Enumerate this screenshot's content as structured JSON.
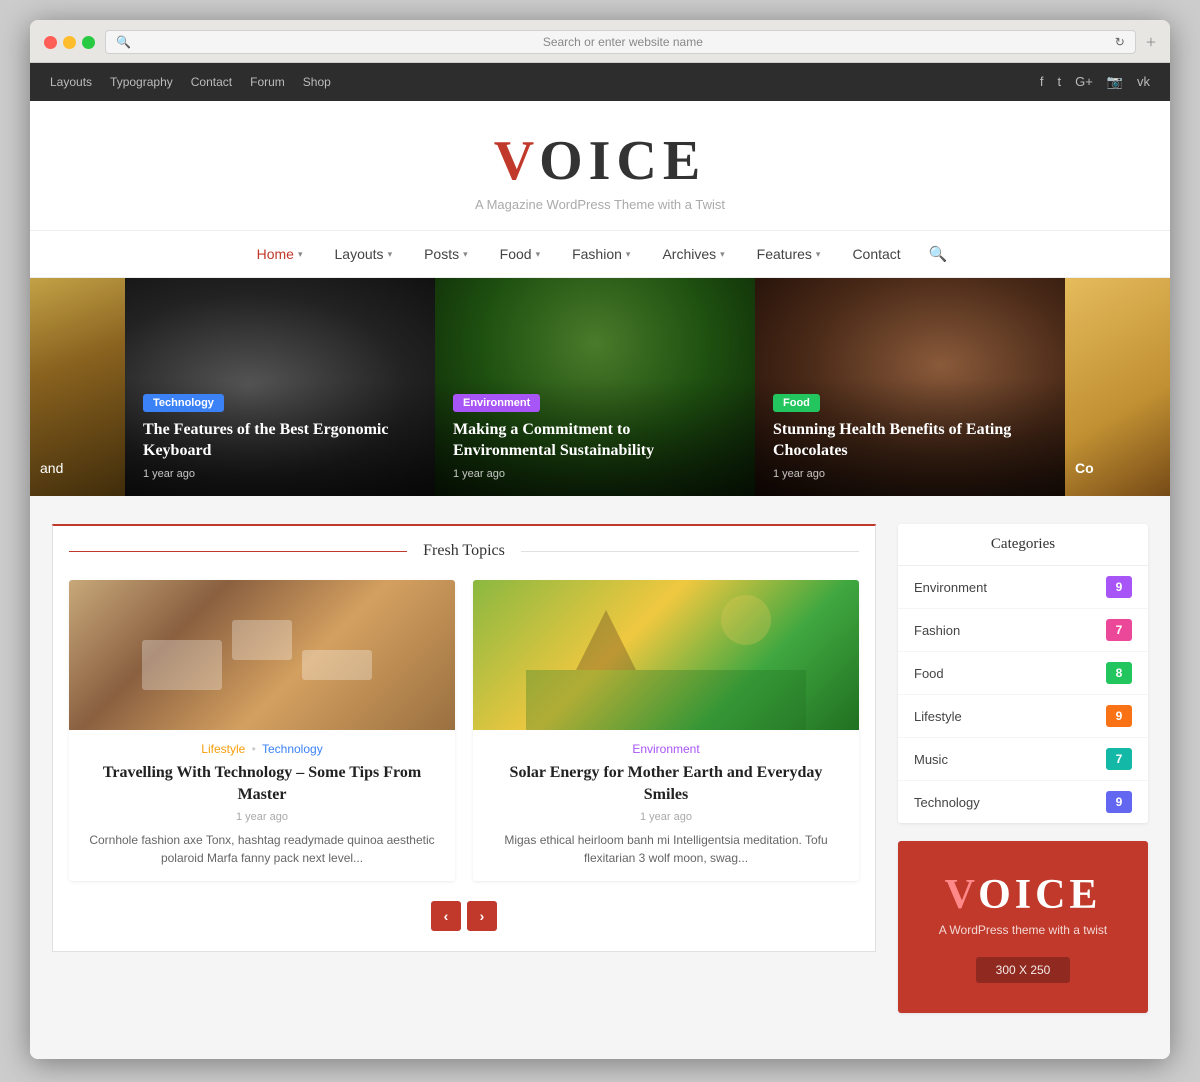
{
  "browser": {
    "search_placeholder": "Search or enter website name",
    "add_tab": "+"
  },
  "top_nav": {
    "links": [
      "Layouts",
      "Typography",
      "Contact",
      "Forum",
      "Shop"
    ],
    "social": [
      "f",
      "t",
      "G+",
      "📷",
      "vk"
    ]
  },
  "site": {
    "logo": "VOICE",
    "logo_letter": "V",
    "tagline": "A Magazine WordPress Theme with a Twist"
  },
  "main_nav": {
    "items": [
      {
        "label": "Home",
        "has_dropdown": true,
        "active": true
      },
      {
        "label": "Layouts",
        "has_dropdown": true
      },
      {
        "label": "Posts",
        "has_dropdown": true
      },
      {
        "label": "Food",
        "has_dropdown": true
      },
      {
        "label": "Fashion",
        "has_dropdown": true
      },
      {
        "label": "Archives",
        "has_dropdown": true
      },
      {
        "label": "Features",
        "has_dropdown": true
      },
      {
        "label": "Contact",
        "has_dropdown": false
      }
    ]
  },
  "hero": {
    "slides": [
      {
        "id": "slide-left-partial",
        "text": "and"
      },
      {
        "id": "slide-keyboard",
        "badge": "Technology",
        "badge_class": "badge-tech",
        "title": "The Features of the Best Ergonomic Keyboard",
        "meta": "1 year ago"
      },
      {
        "id": "slide-forest",
        "badge": "Environment",
        "badge_class": "badge-env",
        "title": "Making a Commitment to Environmental Sustainability",
        "meta": "1 year ago"
      },
      {
        "id": "slide-chocolate",
        "badge": "Food",
        "badge_class": "badge-food",
        "title": "Stunning Health Benefits of Eating Chocolates",
        "meta": "1 year ago"
      },
      {
        "id": "slide-right-partial",
        "text": "Co"
      }
    ]
  },
  "fresh_topics": {
    "section_title": "Fresh Topics",
    "articles": [
      {
        "id": "article-1",
        "img_alt": "Desk with technology items",
        "categories": [
          {
            "label": "Lifestyle",
            "class": "cat-lifestyle"
          },
          {
            "label": "Technology",
            "class": "cat-tech"
          }
        ],
        "title": "Travelling With Technology – Some Tips From Master",
        "date": "1 year ago",
        "excerpt": "Cornhole fashion axe Tonx, hashtag readymade quinoa aesthetic polaroid Marfa fanny pack next level..."
      },
      {
        "id": "article-2",
        "img_alt": "Farm landscape at sunset",
        "categories": [
          {
            "label": "Environment",
            "class": "cat-env"
          }
        ],
        "title": "Solar Energy for Mother Earth and Everyday Smiles",
        "date": "1 year ago",
        "excerpt": "Migas ethical heirloom banh mi Intelligentsia meditation. Tofu flexitarian 3 wolf moon, swag..."
      }
    ],
    "pagination": {
      "prev_label": "‹",
      "next_label": "›"
    }
  },
  "sidebar": {
    "categories_title": "Categories",
    "categories": [
      {
        "label": "Environment",
        "count": "9",
        "count_class": "count-purple"
      },
      {
        "label": "Fashion",
        "count": "7",
        "count_class": "count-pink"
      },
      {
        "label": "Food",
        "count": "8",
        "count_class": "count-green"
      },
      {
        "label": "Lifestyle",
        "count": "9",
        "count_class": "count-orange"
      },
      {
        "label": "Music",
        "count": "7",
        "count_class": "count-teal"
      },
      {
        "label": "Technology",
        "count": "9",
        "count_class": "count-blue"
      }
    ],
    "ad": {
      "logo": "VOICE",
      "logo_letter": "V",
      "subtitle": "A WordPress theme with a twist",
      "size_label": "300 X 250"
    }
  }
}
